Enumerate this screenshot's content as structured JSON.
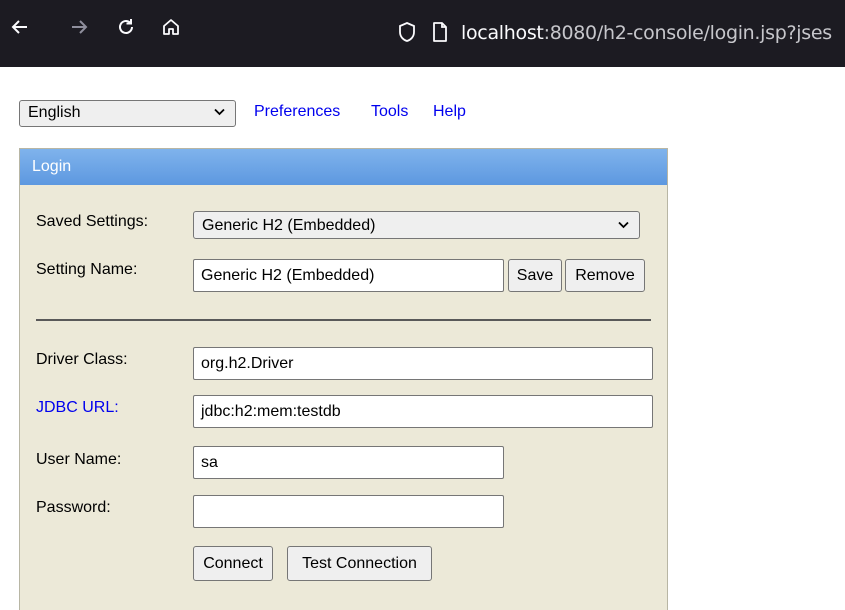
{
  "browser": {
    "url_host": "localhost",
    "url_rest": ":8080/h2-console/login.jsp?jses"
  },
  "toolbar": {
    "language": "English",
    "preferences": "Preferences",
    "tools": "Tools",
    "help": "Help"
  },
  "login": {
    "header": "Login",
    "saved_settings_label": "Saved Settings:",
    "saved_settings_value": "Generic H2 (Embedded)",
    "setting_name_label": "Setting Name:",
    "setting_name_value": "Generic H2 (Embedded)",
    "save": "Save",
    "remove": "Remove",
    "driver_class_label": "Driver Class:",
    "driver_class_value": "org.h2.Driver",
    "jdbc_url_label": "JDBC URL:",
    "jdbc_url_value": "jdbc:h2:mem:testdb",
    "user_name_label": "User Name:",
    "user_name_value": "sa",
    "password_label": "Password:",
    "password_value": "",
    "connect": "Connect",
    "test_connection": "Test Connection"
  },
  "colors": {
    "panel_bg": "#ece9d8",
    "header_blue": "#6ba5e7",
    "link": "#0000ee"
  }
}
